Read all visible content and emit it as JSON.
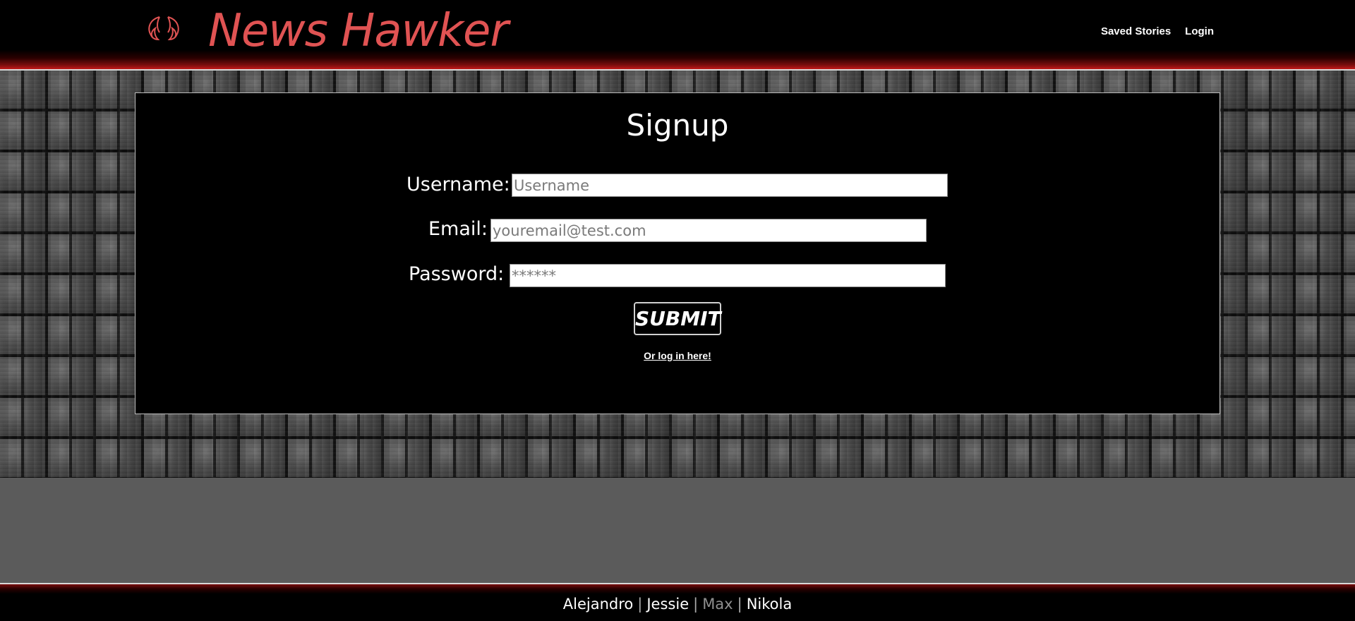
{
  "header": {
    "brand": "News Hawker",
    "logo_icon": "wings-icon",
    "nav": [
      {
        "label": "Saved Stories"
      },
      {
        "label": "Login"
      }
    ]
  },
  "signup": {
    "title": "Signup",
    "username_label": "Username:",
    "username_placeholder": "Username",
    "username_value": "",
    "email_label": "Email:",
    "email_placeholder": "youremail@test.com",
    "email_value": "",
    "password_label": "Password:",
    "password_placeholder": "******",
    "password_value": "",
    "submit_label": "SUBMIT",
    "login_link": "Or log in here!"
  },
  "footer": {
    "separator": "|",
    "names": [
      {
        "name": "Alejandro"
      },
      {
        "name": "Jessie"
      },
      {
        "name": "Max"
      },
      {
        "name": "Nikola"
      }
    ]
  },
  "colors": {
    "brand_red": "#e05353",
    "navbar_bg": "#000000",
    "panel_bg": "#000000",
    "page_bg": "#5b5b5b"
  }
}
